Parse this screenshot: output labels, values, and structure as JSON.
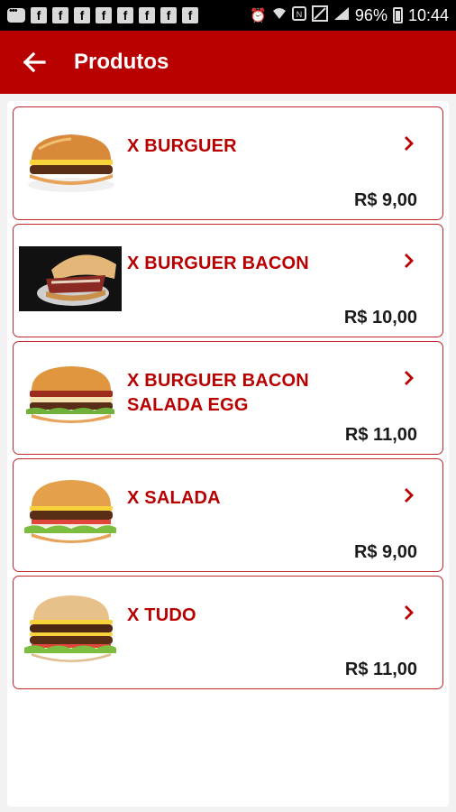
{
  "status_bar": {
    "notification_icons": [
      "message-icon",
      "facebook-icon",
      "facebook-icon",
      "facebook-icon",
      "facebook-icon",
      "facebook-icon",
      "facebook-icon",
      "facebook-icon",
      "facebook-icon"
    ],
    "battery_percent": "96%",
    "time": "10:44"
  },
  "app_bar": {
    "title": "Produtos",
    "color": "#b80000"
  },
  "products": [
    {
      "name": "X BURGUER",
      "price": "R$ 9,00"
    },
    {
      "name": "X BURGUER BACON",
      "price": "R$ 10,00"
    },
    {
      "name": "X BURGUER BACON SALADA EGG",
      "price": "R$ 11,00"
    },
    {
      "name": "X SALADA",
      "price": "R$ 9,00"
    },
    {
      "name": "X TUDO",
      "price": "R$ 11,00"
    }
  ],
  "colors": {
    "accent": "#b80000",
    "card_border": "#c0272d"
  }
}
